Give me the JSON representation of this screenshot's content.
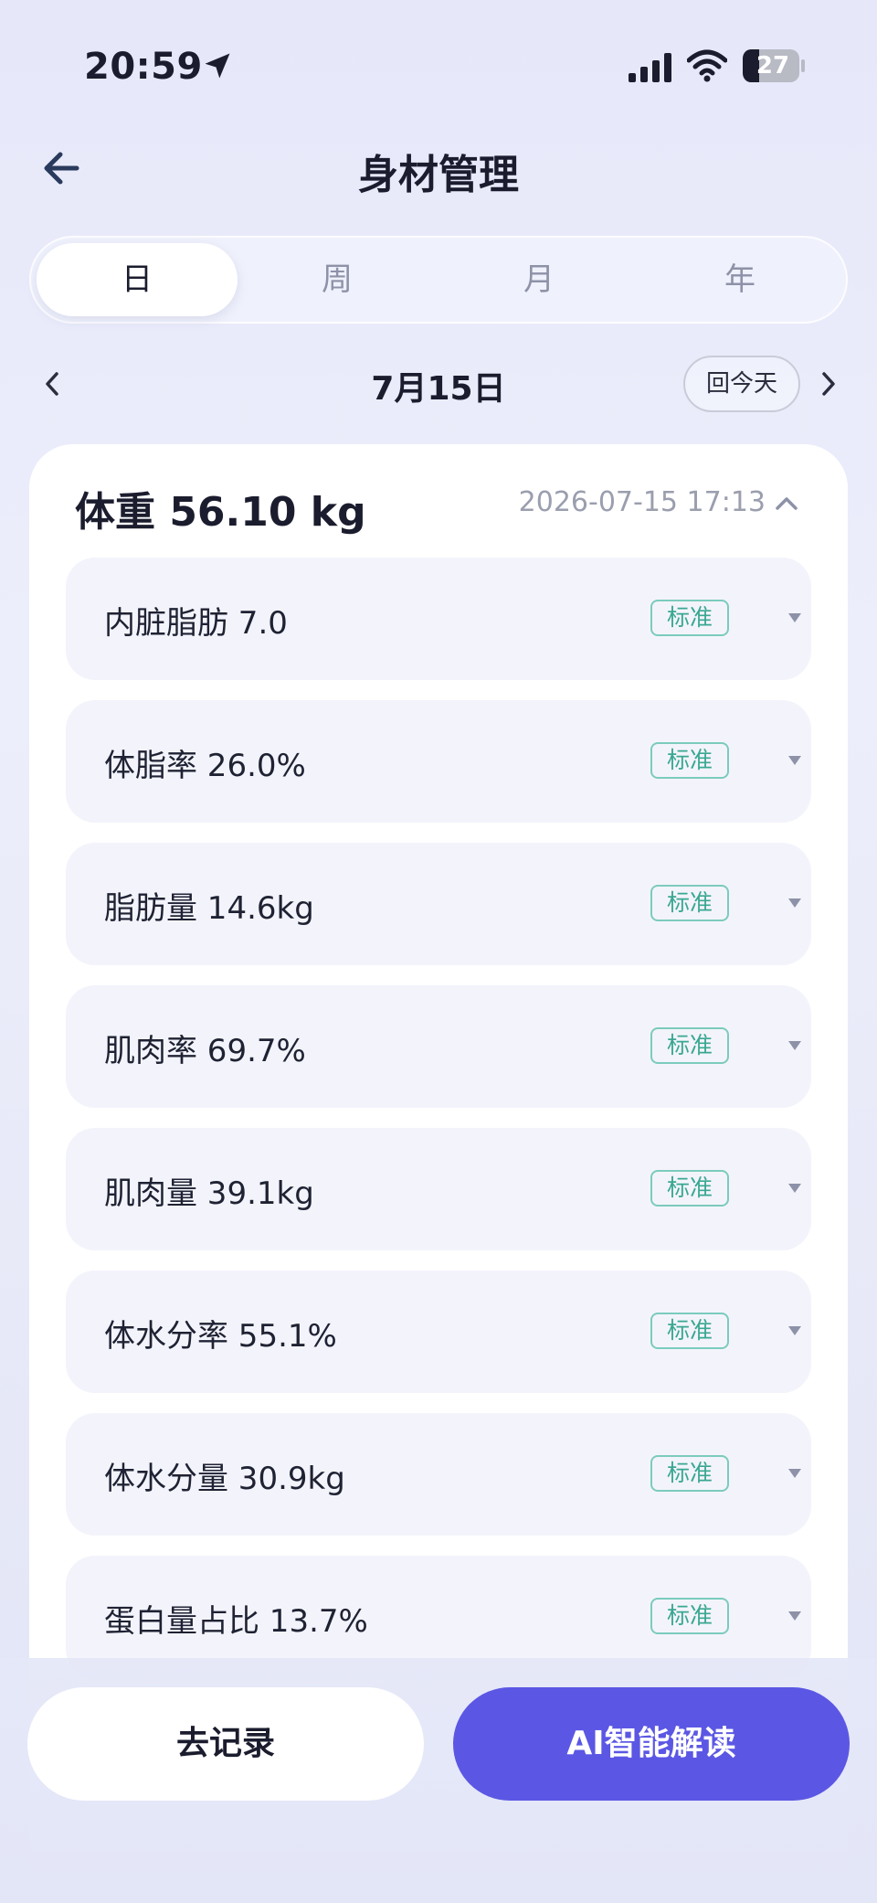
{
  "status_bar": {
    "time": "20:59",
    "battery": "27"
  },
  "header": {
    "title": "身材管理"
  },
  "tabs": [
    {
      "label": "日",
      "active": true
    },
    {
      "label": "周",
      "active": false
    },
    {
      "label": "月",
      "active": false
    },
    {
      "label": "年",
      "active": false
    }
  ],
  "date_nav": {
    "date": "7月15日",
    "today_label": "回今天"
  },
  "weight": {
    "label": "体重 56.10 kg",
    "timestamp": "2026-07-15 17:13"
  },
  "metrics": [
    {
      "text": "内脏脂肪 7.0",
      "badge": "标准"
    },
    {
      "text": "体脂率 26.0%",
      "badge": "标准"
    },
    {
      "text": "脂肪量 14.6kg",
      "badge": "标准"
    },
    {
      "text": "肌肉率 69.7%",
      "badge": "标准"
    },
    {
      "text": "肌肉量 39.1kg",
      "badge": "标准"
    },
    {
      "text": "体水分率 55.1%",
      "badge": "标准"
    },
    {
      "text": "体水分量 30.9kg",
      "badge": "标准"
    },
    {
      "text": "蛋白量占比 13.7%",
      "badge": "标准"
    }
  ],
  "actions": {
    "record_label": "去记录",
    "ai_label": "AI智能解读"
  },
  "colors": {
    "accent": "#5b57e4",
    "badge": "#3aa792",
    "background": "#e9ebfa"
  }
}
